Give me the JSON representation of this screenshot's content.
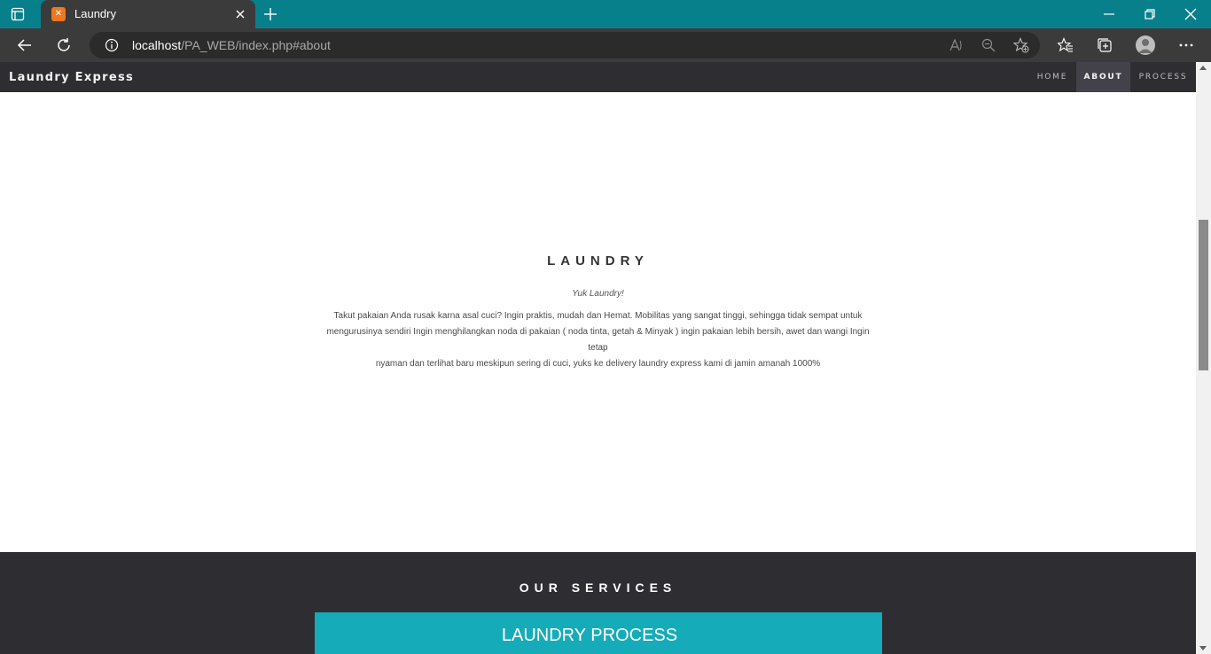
{
  "browser": {
    "tab": {
      "title": "Laundry",
      "favicon_icon": "xampp-icon"
    },
    "address": {
      "host": "localhost",
      "path": "/PA_WEB/index.php#about"
    }
  },
  "site": {
    "brand": "Laundry Express",
    "nav": [
      {
        "label": "HOME",
        "active": false
      },
      {
        "label": "ABOUT",
        "active": true
      },
      {
        "label": "PROCESS",
        "active": false
      }
    ]
  },
  "about": {
    "title": "LAUNDRY",
    "subtitle": "Yuk Laundry!",
    "lines": [
      "Takut pakaian Anda rusak karna asal cuci? Ingin praktis, mudah dan Hemat. Mobilitas yang sangat tinggi, sehingga tidak sempat untuk",
      "mengurusinya sendiri Ingin menghilangkan noda di pakaian ( noda tinta, getah & Minyak ) ingin pakaian lebih bersih, awet dan wangi Ingin tetap",
      "nyaman dan terlihat baru meskipun sering di cuci, yuks ke delivery laundry express kami di jamin amanah 1000%"
    ]
  },
  "services": {
    "title": "OUR SERVICES",
    "banner": "LAUNDRY PROCESS"
  },
  "colors": {
    "tabbar": "#08808c",
    "toolbar": "#3b3b3b",
    "sitenav": "#2e2d32",
    "accent": "#16abb8"
  }
}
